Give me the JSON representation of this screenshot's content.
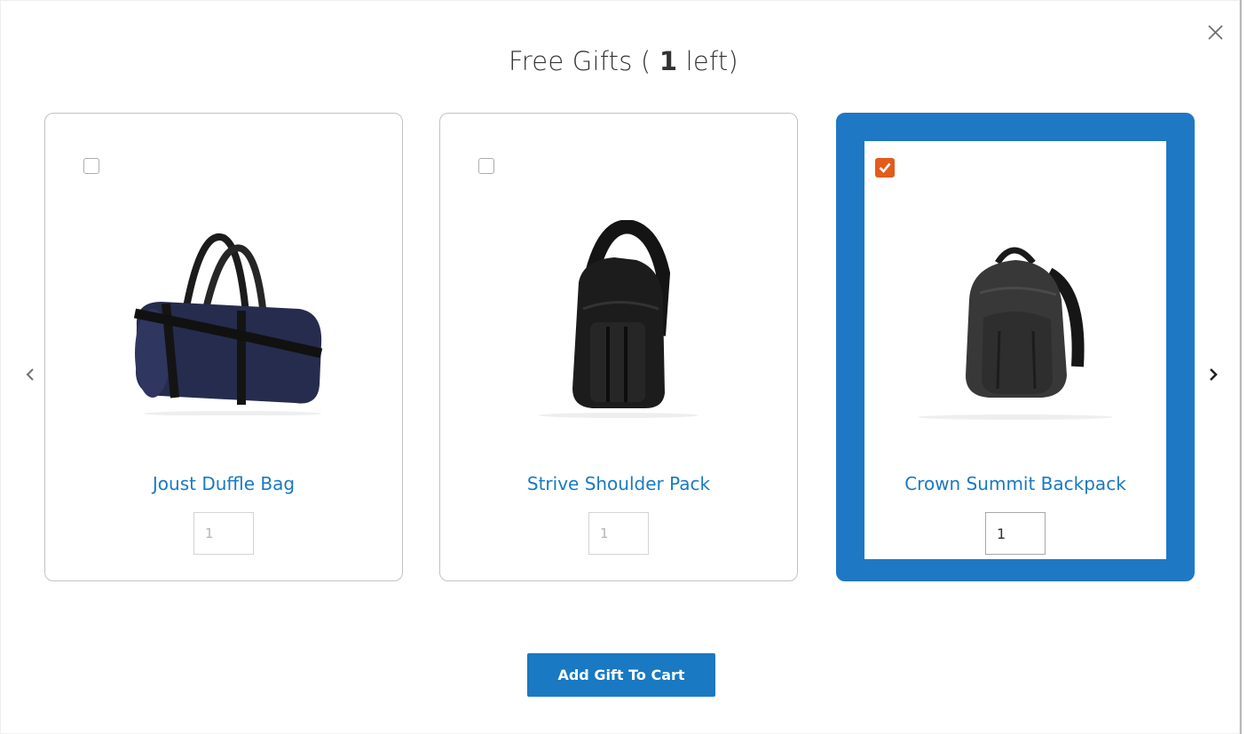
{
  "dialog": {
    "title_prefix": "Free Gifts ( ",
    "gifts_left": "1",
    "title_suffix": " left)",
    "close_icon": "close-icon",
    "prev_icon": "chevron-left-icon",
    "next_icon": "chevron-right-icon"
  },
  "products": [
    {
      "name": "Joust Duffle Bag",
      "qty": "1",
      "checked": false
    },
    {
      "name": "Strive Shoulder Pack",
      "qty": "1",
      "checked": false
    },
    {
      "name": "Crown Summit Backpack",
      "qty": "1",
      "checked": true
    }
  ],
  "actions": {
    "add_label": "Add Gift To Cart"
  },
  "colors": {
    "accent": "#1979c3",
    "selected_border": "#1f78c4",
    "checkbox_checked": "#e35b1d"
  }
}
